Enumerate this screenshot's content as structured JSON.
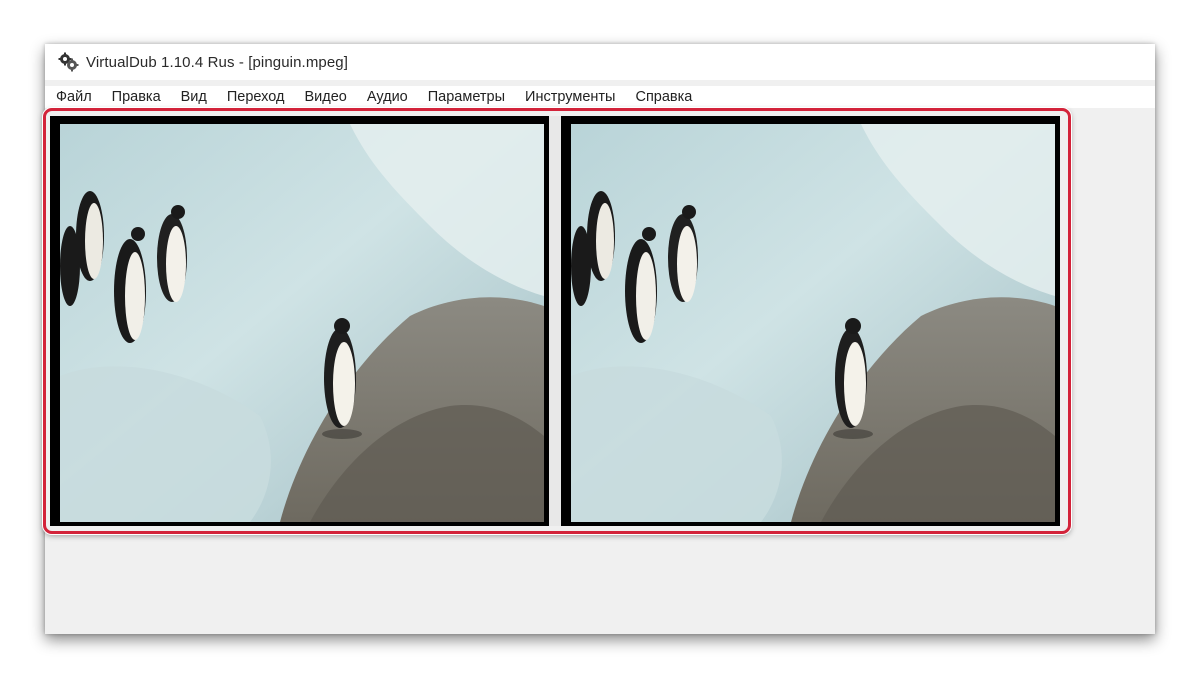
{
  "window": {
    "title": "VirtualDub 1.10.4 Rus - [pinguin.mpeg]",
    "icon": "virtualdub-gear-icon"
  },
  "menu": [
    {
      "label": "Файл"
    },
    {
      "label": "Правка"
    },
    {
      "label": "Вид"
    },
    {
      "label": "Переход"
    },
    {
      "label": "Видео"
    },
    {
      "label": "Аудио"
    },
    {
      "label": "Параметры"
    },
    {
      "label": "Инструменты"
    },
    {
      "label": "Справка"
    }
  ],
  "panes": {
    "input": {
      "content": "penguins-on-ice-video-frame"
    },
    "output": {
      "content": "penguins-on-ice-video-frame"
    }
  },
  "colors": {
    "highlight": "#d3233a",
    "window_bg": "#f0f0f0"
  }
}
